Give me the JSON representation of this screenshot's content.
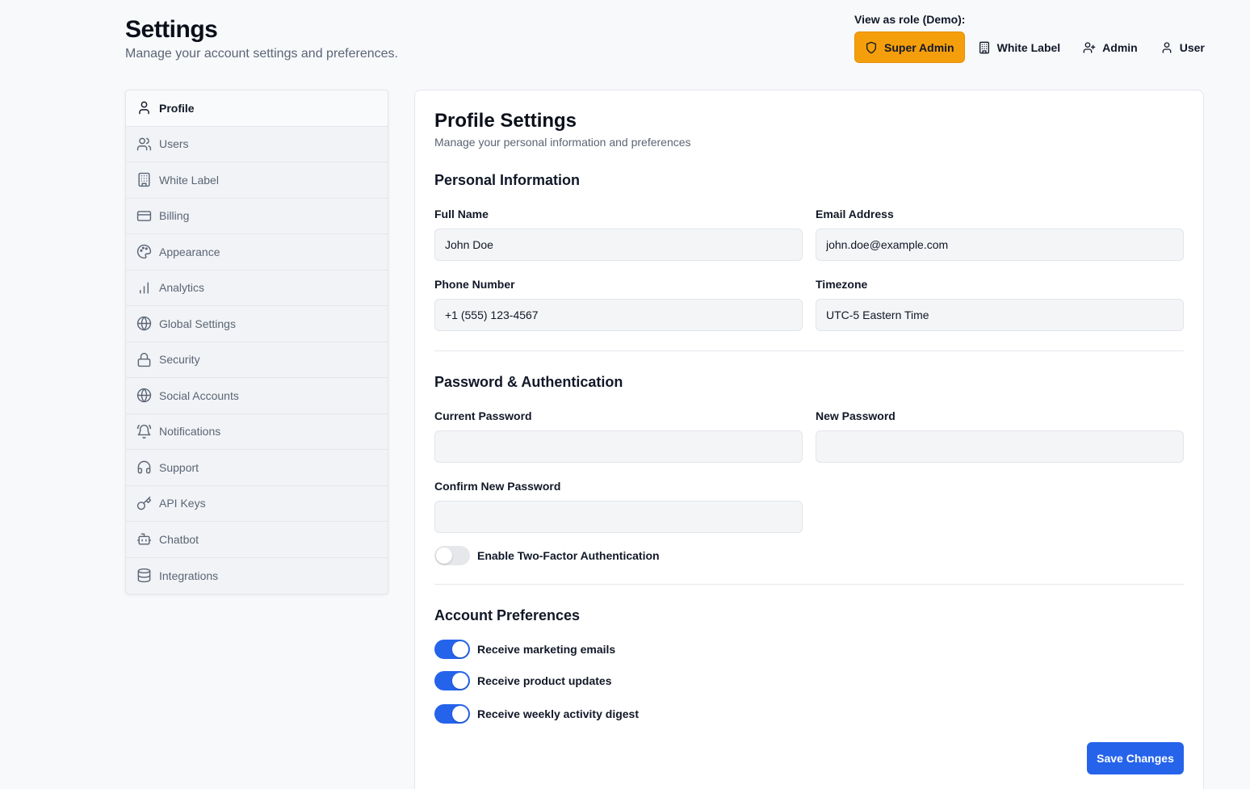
{
  "header": {
    "title": "Settings",
    "subtitle": "Manage your account settings and preferences."
  },
  "role_switcher": {
    "label": "View as role (Demo):",
    "roles": [
      {
        "label": "Super Admin",
        "icon": "shield-icon",
        "active": true
      },
      {
        "label": "White Label",
        "icon": "building-icon",
        "active": false
      },
      {
        "label": "Admin",
        "icon": "user-plus-icon",
        "active": false
      },
      {
        "label": "User",
        "icon": "user-icon",
        "active": false
      }
    ],
    "active_color": "#f59e0b"
  },
  "sidebar": {
    "items": [
      {
        "label": "Profile",
        "icon": "user-icon",
        "active": true
      },
      {
        "label": "Users",
        "icon": "users-icon"
      },
      {
        "label": "White Label",
        "icon": "building-icon"
      },
      {
        "label": "Billing",
        "icon": "credit-card-icon"
      },
      {
        "label": "Appearance",
        "icon": "palette-icon"
      },
      {
        "label": "Analytics",
        "icon": "bar-chart-icon"
      },
      {
        "label": "Global Settings",
        "icon": "globe-icon"
      },
      {
        "label": "Security",
        "icon": "lock-icon"
      },
      {
        "label": "Social Accounts",
        "icon": "globe-icon"
      },
      {
        "label": "Notifications",
        "icon": "bell-icon"
      },
      {
        "label": "Support",
        "icon": "headphones-icon"
      },
      {
        "label": "API Keys",
        "icon": "key-icon"
      },
      {
        "label": "Chatbot",
        "icon": "bot-icon"
      },
      {
        "label": "Integrations",
        "icon": "database-icon"
      }
    ]
  },
  "profile": {
    "title": "Profile Settings",
    "subtitle": "Manage your personal information and preferences",
    "personal": {
      "title": "Personal Information",
      "full_name_label": "Full Name",
      "full_name_value": "John Doe",
      "email_label": "Email Address",
      "email_value": "john.doe@example.com",
      "phone_label": "Phone Number",
      "phone_value": "+1 (555) 123-4567",
      "timezone_label": "Timezone",
      "timezone_value": "UTC-5 Eastern Time"
    },
    "password": {
      "title": "Password & Authentication",
      "current_label": "Current Password",
      "current_value": "",
      "new_label": "New Password",
      "new_value": "",
      "confirm_label": "Confirm New Password",
      "confirm_value": "",
      "two_factor_label": "Enable Two-Factor Authentication",
      "two_factor_enabled": false
    },
    "preferences": {
      "title": "Account Preferences",
      "marketing_label": "Receive marketing emails",
      "marketing_enabled": true,
      "updates_label": "Receive product updates",
      "updates_enabled": true,
      "digest_label": "Receive weekly activity digest",
      "digest_enabled": true
    },
    "save_label": "Save Changes"
  },
  "colors": {
    "primary": "#2563eb",
    "accent": "#f59e0b"
  }
}
